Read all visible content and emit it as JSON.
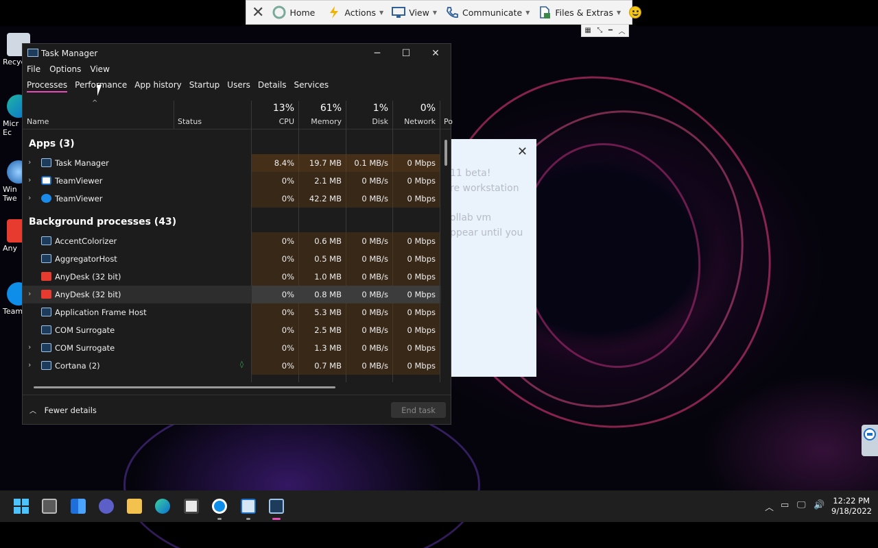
{
  "teamviewer_toolbar": {
    "home": "Home",
    "actions": "Actions",
    "view": "View",
    "communicate": "Communicate",
    "files": "Files & Extras"
  },
  "desktop_icons": [
    "Recyc",
    "Micr\nEc",
    "Win\nTwe",
    "Any",
    "Team"
  ],
  "background_dialog": {
    "lines": [
      "11 beta!",
      "re workstation",
      "ollab vm",
      "ppear until you"
    ]
  },
  "task_manager": {
    "title": "Task Manager",
    "menu": [
      "File",
      "Options",
      "View"
    ],
    "tabs": [
      "Processes",
      "Performance",
      "App history",
      "Startup",
      "Users",
      "Details",
      "Services"
    ],
    "columns": {
      "name": "Name",
      "status": "Status",
      "cpu": {
        "pct": "13%",
        "label": "CPU"
      },
      "memory": {
        "pct": "61%",
        "label": "Memory"
      },
      "disk": {
        "pct": "1%",
        "label": "Disk"
      },
      "network": {
        "pct": "0%",
        "label": "Network"
      },
      "power": "Po"
    },
    "apps_group": "Apps (3)",
    "apps": [
      {
        "name": "Task Manager",
        "cpu": "8.4%",
        "memory": "19.7 MB",
        "disk": "0.1 MB/s",
        "network": "0 Mbps"
      },
      {
        "name": "TeamViewer",
        "cpu": "0%",
        "memory": "2.1 MB",
        "disk": "0 MB/s",
        "network": "0 Mbps"
      },
      {
        "name": "TeamViewer",
        "cpu": "0%",
        "memory": "42.2 MB",
        "disk": "0 MB/s",
        "network": "0 Mbps"
      }
    ],
    "bg_group": "Background processes (43)",
    "background": [
      {
        "name": "AccentColorizer",
        "cpu": "0%",
        "memory": "0.6 MB",
        "disk": "0 MB/s",
        "network": "0 Mbps"
      },
      {
        "name": "AggregatorHost",
        "cpu": "0%",
        "memory": "0.5 MB",
        "disk": "0 MB/s",
        "network": "0 Mbps"
      },
      {
        "name": "AnyDesk (32 bit)",
        "cpu": "0%",
        "memory": "1.0 MB",
        "disk": "0 MB/s",
        "network": "0 Mbps"
      },
      {
        "name": "AnyDesk (32 bit)",
        "cpu": "0%",
        "memory": "0.8 MB",
        "disk": "0 MB/s",
        "network": "0 Mbps"
      },
      {
        "name": "Application Frame Host",
        "cpu": "0%",
        "memory": "5.3 MB",
        "disk": "0 MB/s",
        "network": "0 Mbps"
      },
      {
        "name": "COM Surrogate",
        "cpu": "0%",
        "memory": "2.5 MB",
        "disk": "0 MB/s",
        "network": "0 Mbps"
      },
      {
        "name": "COM Surrogate",
        "cpu": "0%",
        "memory": "1.3 MB",
        "disk": "0 MB/s",
        "network": "0 Mbps"
      },
      {
        "name": "Cortana (2)",
        "cpu": "0%",
        "memory": "0.7 MB",
        "disk": "0 MB/s",
        "network": "0 Mbps"
      }
    ],
    "fewer_details": "Fewer details",
    "end_task": "End task"
  },
  "clock": {
    "time": "12:22 PM",
    "date": "9/18/2022"
  },
  "colors": {
    "accent": "#e64fb7",
    "tm_bg": "#1c1c1c",
    "heat": "#5a3714",
    "taskbar": "#1f1f1f"
  }
}
